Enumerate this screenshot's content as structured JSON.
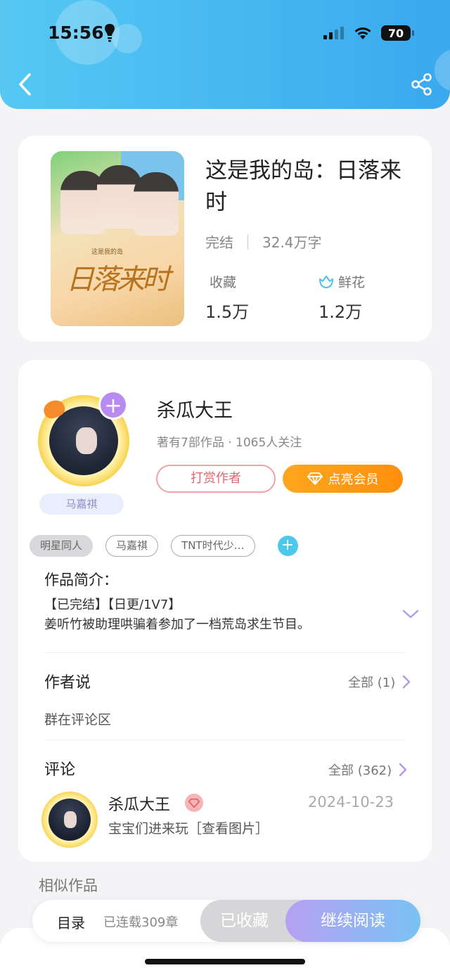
{
  "status_bar": {
    "time": "15:56",
    "battery": "70"
  },
  "book": {
    "title": "这是我的岛：日落来时",
    "status": "完结",
    "word_count": "32.4万字",
    "favorites_label": "收藏",
    "favorites_value": "1.5万",
    "flowers_label": "鲜花",
    "flowers_value": "1.2万",
    "cover_calligraphy": "日落来时",
    "cover_subtitle": "这是我的岛"
  },
  "author": {
    "name": "杀瓜大王",
    "meta": "著有7部作品 · 1065人关注",
    "avatar_tag": "马嘉祺",
    "reward_button": "打赏作者",
    "vip_button": "点亮会员"
  },
  "tags": [
    "明星同人",
    "马嘉祺",
    "TNT时代少…"
  ],
  "intro": {
    "title": "作品简介：",
    "line1": "【已完结】【日更/1V7】",
    "line2": "姜听竹被助理哄骗着参加了一档荒岛求生节目。"
  },
  "author_says": {
    "title": "作者说",
    "more": "全部 (1)",
    "text": "群在评论区"
  },
  "comments": {
    "title": "评论",
    "more": "全部 (362)",
    "items": [
      {
        "name": "杀瓜大王",
        "date": "2024-10-23",
        "text": "宝宝们进来玩［查看图片］"
      }
    ]
  },
  "similar": {
    "title": "相似作品"
  },
  "bottom_bar": {
    "toc": "目录",
    "chapters": "已连载309章",
    "collected": "已收藏",
    "continue": "继续阅读"
  }
}
